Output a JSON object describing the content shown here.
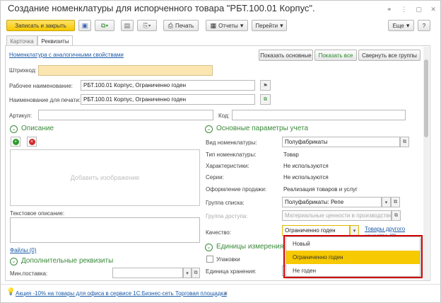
{
  "window": {
    "title": "Создание номенклатуры для испорченного товара \"РБТ.100.01 Корпус\".",
    "icons": [
      "link-icon",
      "kebab-icon",
      "restore-icon",
      "close-icon"
    ]
  },
  "toolbar": {
    "save_close": "Записать и закрыть",
    "print": "Печать",
    "reports": "Отчеты",
    "goto": "Перейти",
    "more": "Еще",
    "help": "?"
  },
  "tabs": [
    {
      "label": "Карточка",
      "active": false
    },
    {
      "label": "Реквизиты",
      "active": true
    }
  ],
  "top_row": {
    "analog_link": "Номенклатура с аналогичными свойствами",
    "show_main": "Показать основные",
    "show_all": "Показать все",
    "collapse_all": "Свернуть все группы"
  },
  "form": {
    "barcode_label": "Штрихкод:",
    "barcode_value": "",
    "work_name_label": "Рабочее наименование:",
    "work_name_value": "РБТ.100.01 Корпус, Ограниченно годен",
    "print_name_label": "Наименование для печати:",
    "print_name_value": "РБТ.100.01 Корпус, Ограниченно годен",
    "article_label": "Артикул:",
    "code_label": "Код:"
  },
  "left": {
    "description_title": "Описание",
    "add_image": "Добавить изображение",
    "text_desc_label": "Текстовое описание:",
    "files_link": "Файлы (0)",
    "extra_title": "Дополнительные реквизиты",
    "min_supply_label": "Мин.поставка:"
  },
  "right": {
    "main_params_title": "Основные параметры учета",
    "kind_label": "Вид номенклатуры:",
    "kind_value": "Полуфабрикаты",
    "type_label": "Тип номенклатуры:",
    "type_value": "Товар",
    "characteristics_label": "Характеристики:",
    "characteristics_value": "Не используются",
    "series_label": "Серии:",
    "series_value": "Не используются",
    "sales_label": "Оформление продажи:",
    "sales_value": "Реализация товаров и услуг",
    "list_group_label": "Группа списка:",
    "list_group_value": "Полуфабрикаты: Репе",
    "access_group_label": "Группа доступа:",
    "access_group_value": "Материальные ценности в производстве",
    "quality_label": "Качество:",
    "quality_value": "Ограниченно годен",
    "other_quality_link_1": "Товары другого",
    "other_quality_link_2": "качества (0)",
    "units_title": "Единицы измерения и",
    "packages_label": "Упаковки",
    "storage_unit_label": "Единица хранения:"
  },
  "dropdown": {
    "items": [
      {
        "label": "Новый",
        "selected": false
      },
      {
        "label": "Ограниченно годен",
        "selected": true
      },
      {
        "label": "Не годен",
        "selected": false
      }
    ],
    "highlight_color": "#d00000"
  },
  "footer": {
    "promo_link": "Акция -10% на товары для офиса в сервисе 1С:Бизнес-сеть Торговая площадка",
    "close_mark": "×"
  },
  "colors": {
    "accent_yellow": "#f6c800",
    "section_green": "#3a8a3a",
    "link_blue": "#1a5aa8",
    "red_box": "#d00000"
  }
}
